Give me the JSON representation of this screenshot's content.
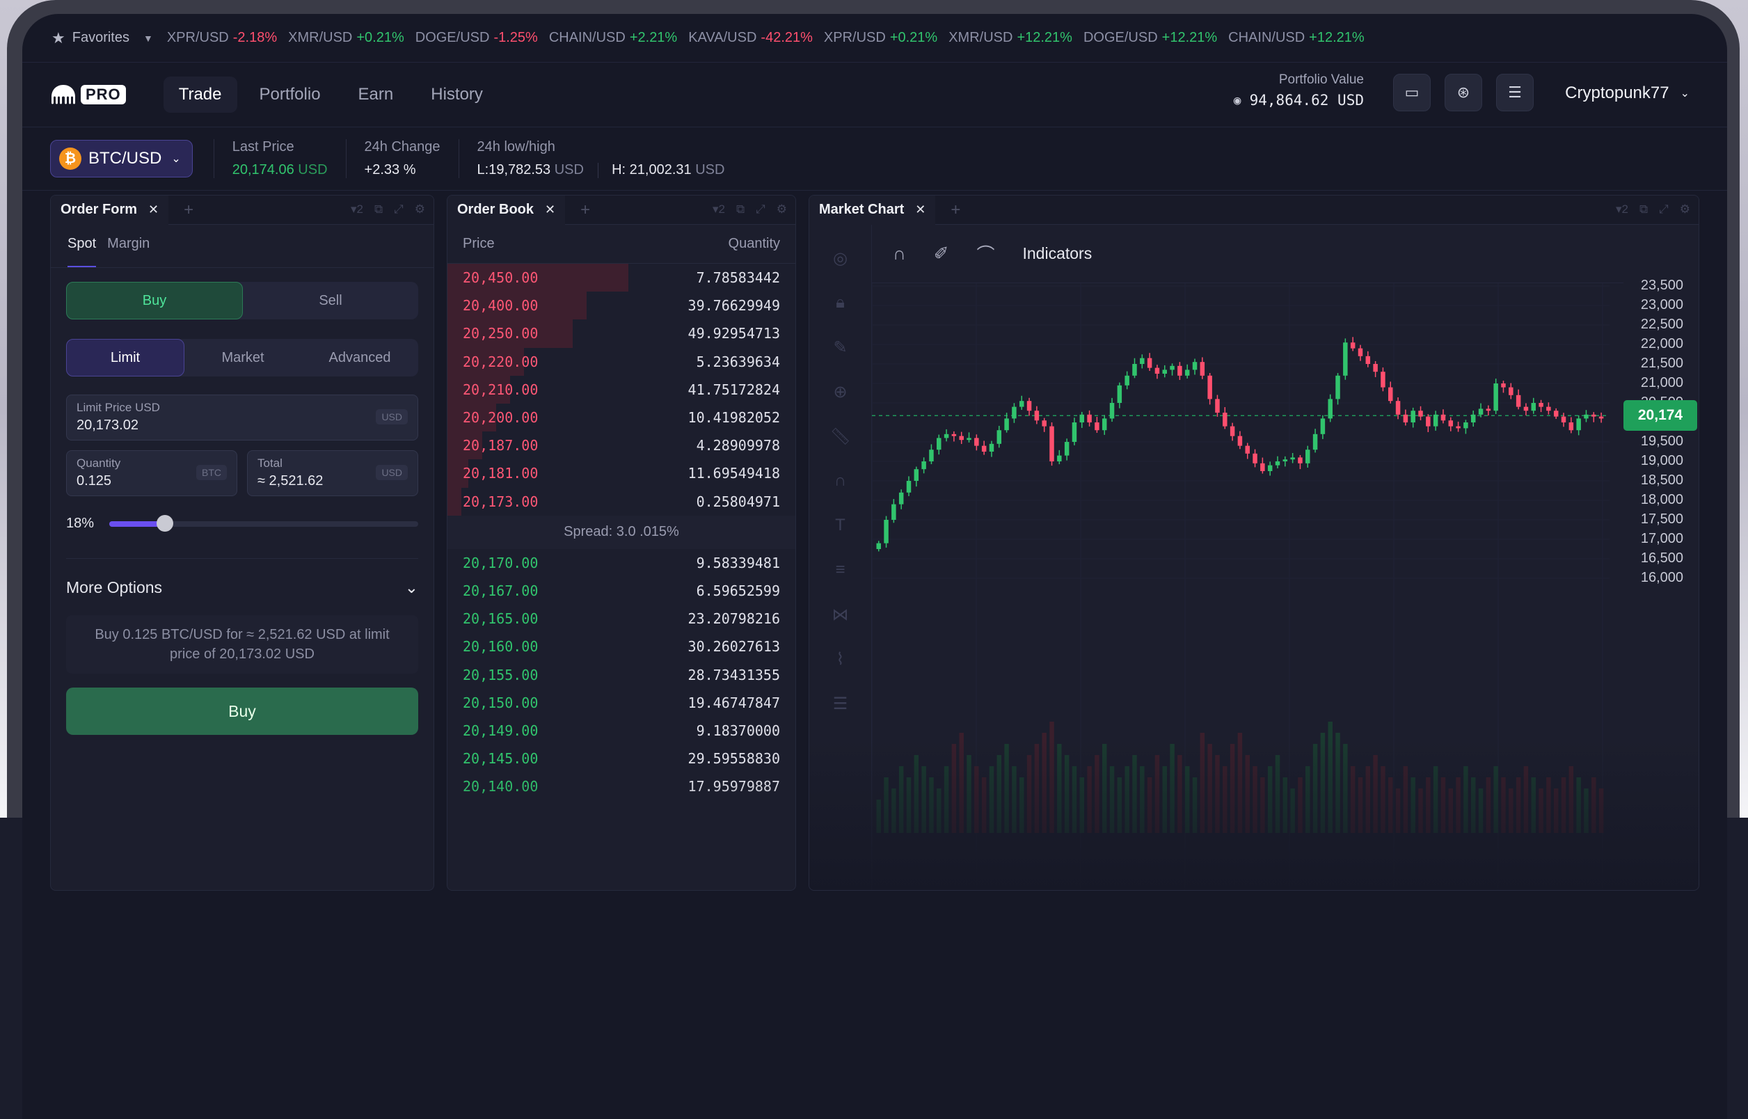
{
  "ticker": {
    "favorites_label": "Favorites",
    "items": [
      {
        "symbol": "XPR/USD",
        "change": "-2.18%",
        "dir": "neg"
      },
      {
        "symbol": "XMR/USD",
        "change": "+0.21%",
        "dir": "pos"
      },
      {
        "symbol": "DOGE/USD",
        "change": "-1.25%",
        "dir": "neg"
      },
      {
        "symbol": "CHAIN/USD",
        "change": "+2.21%",
        "dir": "pos"
      },
      {
        "symbol": "KAVA/USD",
        "change": "-42.21%",
        "dir": "neg"
      },
      {
        "symbol": "XPR/USD",
        "change": "+0.21%",
        "dir": "pos"
      },
      {
        "symbol": "XMR/USD",
        "change": "+12.21%",
        "dir": "pos"
      },
      {
        "symbol": "DOGE/USD",
        "change": "+12.21%",
        "dir": "pos"
      },
      {
        "symbol": "CHAIN/USD",
        "change": "+12.21%",
        "dir": "pos"
      }
    ]
  },
  "nav": {
    "logo_text": "PRO",
    "tabs": [
      "Trade",
      "Portfolio",
      "Earn",
      "History"
    ],
    "active_tab": "Trade",
    "portfolio_label": "Portfolio Value",
    "portfolio_value": "94,864.62 USD",
    "username": "Cryptopunk77"
  },
  "pair": {
    "name": "BTC/USD",
    "coin_glyph": "₿",
    "last_price_label": "Last Price",
    "last_price": "20,174.06",
    "last_price_unit": "USD",
    "change_label": "24h Change",
    "change_value": "+2.33 %",
    "lowhigh_label": "24h low/high",
    "low": "L:19,782.53",
    "high": "H: 21,002.31",
    "unit": "USD"
  },
  "order_form": {
    "title": "Order Form",
    "subtabs": [
      "Spot",
      "Margin"
    ],
    "side_buy": "Buy",
    "side_sell": "Sell",
    "types": [
      "Limit",
      "Market",
      "Advanced"
    ],
    "limit_label": "Limit Price USD",
    "limit_value": "20,173.02",
    "limit_unit": "USD",
    "qty_label": "Quantity",
    "qty_value": "0.125",
    "qty_unit": "BTC",
    "total_label": "Total",
    "total_value": "≈ 2,521.62",
    "total_unit": "USD",
    "slider_label": "18%",
    "slider_fraction": 0.18,
    "more_options": "More Options",
    "summary": "Buy 0.125 BTC/USD for ≈ 2,521.62 USD at limit price of 20,173.02 USD",
    "submit": "Buy"
  },
  "order_book": {
    "title": "Order Book",
    "col_price": "Price",
    "col_qty": "Quantity",
    "asks": [
      {
        "price": "20,450.00",
        "qty": "7.78583442"
      },
      {
        "price": "20,400.00",
        "qty": "39.76629949"
      },
      {
        "price": "20,250.00",
        "qty": "49.92954713"
      },
      {
        "price": "20,220.00",
        "qty": "5.23639634"
      },
      {
        "price": "20,210.00",
        "qty": "41.75172824"
      },
      {
        "price": "20,200.00",
        "qty": "10.41982052"
      },
      {
        "price": "20,187.00",
        "qty": "4.28909978"
      },
      {
        "price": "20,181.00",
        "qty": "11.69549418"
      },
      {
        "price": "20,173.00",
        "qty": "0.25804971"
      }
    ],
    "spread": "Spread: 3.0 .015%",
    "bids": [
      {
        "price": "20,170.00",
        "qty": "9.58339481"
      },
      {
        "price": "20,167.00",
        "qty": "6.59652599"
      },
      {
        "price": "20,165.00",
        "qty": "23.20798216"
      },
      {
        "price": "20,160.00",
        "qty": "30.26027613"
      },
      {
        "price": "20,155.00",
        "qty": "28.73431355"
      },
      {
        "price": "20,150.00",
        "qty": "19.46747847"
      },
      {
        "price": "20,149.00",
        "qty": "9.18370000"
      },
      {
        "price": "20,145.00",
        "qty": "29.59558830"
      },
      {
        "price": "20,140.00",
        "qty": "17.95979887"
      }
    ]
  },
  "market_chart": {
    "title": "Market Chart",
    "indicators_label": "Indicators",
    "last_price_tag": "20,174"
  },
  "colors": {
    "up": "#31c46d",
    "down": "#ff4f6e",
    "accent": "#5b4fe0",
    "bg": "#161826"
  },
  "chart_data": {
    "type": "candlestick",
    "y_ticks": [
      23500,
      23000,
      22500,
      22000,
      21500,
      21000,
      20500,
      19500,
      19000,
      18500,
      18000,
      17500,
      17000,
      16500,
      16000
    ],
    "ylim": [
      15800,
      23800
    ],
    "last_price": 20174,
    "closes": [
      16900,
      17500,
      17900,
      18200,
      18500,
      18800,
      19000,
      19300,
      19600,
      19700,
      19650,
      19550,
      19600,
      19400,
      19250,
      19450,
      19800,
      20100,
      20400,
      20550,
      20300,
      20050,
      19900,
      19000,
      19150,
      19500,
      20000,
      20200,
      20000,
      19800,
      20100,
      20500,
      20950,
      21200,
      21500,
      21650,
      21400,
      21250,
      21350,
      21450,
      21200,
      21350,
      21550,
      21200,
      20600,
      20250,
      19900,
      19650,
      19400,
      19200,
      18950,
      18750,
      18900,
      19000,
      19050,
      19100,
      18950,
      19300,
      19700,
      20100,
      20600,
      21200,
      22050,
      21900,
      21700,
      21500,
      21300,
      20900,
      20550,
      20200,
      20000,
      20300,
      20150,
      19900,
      20200,
      20050,
      19900,
      19850,
      20000,
      20200,
      20350,
      20300,
      21000,
      20900,
      20700,
      20400,
      20300,
      20500,
      20400,
      20300,
      20150,
      20000,
      19800,
      20100,
      20200,
      20150,
      20100
    ],
    "volumes": [
      0.3,
      0.5,
      0.4,
      0.6,
      0.5,
      0.7,
      0.6,
      0.5,
      0.4,
      0.6,
      0.8,
      0.9,
      0.7,
      0.6,
      0.5,
      0.6,
      0.7,
      0.8,
      0.6,
      0.5,
      0.7,
      0.8,
      0.9,
      1.0,
      0.8,
      0.7,
      0.6,
      0.5,
      0.6,
      0.7,
      0.8,
      0.6,
      0.5,
      0.6,
      0.7,
      0.6,
      0.5,
      0.7,
      0.6,
      0.8,
      0.7,
      0.6,
      0.5,
      0.9,
      0.8,
      0.7,
      0.6,
      0.8,
      0.9,
      0.7,
      0.6,
      0.5,
      0.6,
      0.7,
      0.5,
      0.4,
      0.5,
      0.6,
      0.8,
      0.9,
      1.0,
      0.9,
      0.8,
      0.6,
      0.5,
      0.6,
      0.7,
      0.6,
      0.5,
      0.4,
      0.6,
      0.5,
      0.4,
      0.5,
      0.6,
      0.5,
      0.4,
      0.5,
      0.6,
      0.5,
      0.4,
      0.5,
      0.6,
      0.5,
      0.4,
      0.5,
      0.6,
      0.5,
      0.4,
      0.5,
      0.4,
      0.5,
      0.6,
      0.5,
      0.4,
      0.5,
      0.4
    ]
  }
}
